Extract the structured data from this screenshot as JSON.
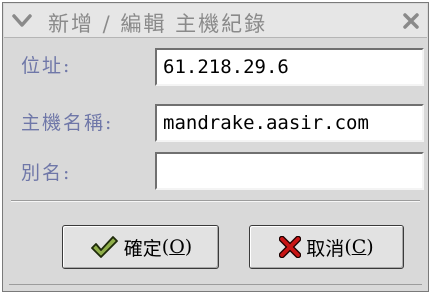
{
  "window": {
    "title": "新增 / 編輯 主機紀錄",
    "menu_icon": "chevron-down-icon",
    "close_icon": "close-icon"
  },
  "form": {
    "address_label": "位址:",
    "address_value": "61.218.29.6",
    "hostname_label": "主機名稱:",
    "hostname_value": "mandrake.aasir.com",
    "alias_label": "別名:",
    "alias_value": ""
  },
  "buttons": {
    "ok_label": "確定",
    "ok_paren_open": "(",
    "ok_mnemonic": "O",
    "ok_paren_close": ")",
    "ok_icon": "checkmark-icon",
    "cancel_label": "取消",
    "cancel_paren_open": "(",
    "cancel_mnemonic": "C",
    "cancel_paren_close": ")",
    "cancel_icon": "x-mark-icon"
  },
  "colors": {
    "label_text": "#6f77a8",
    "title_text": "#8a8a8a",
    "dialog_bg": "#d9d9d9",
    "cancel_icon_red": "#c81414",
    "ok_icon_green": "#5e7d2a"
  }
}
